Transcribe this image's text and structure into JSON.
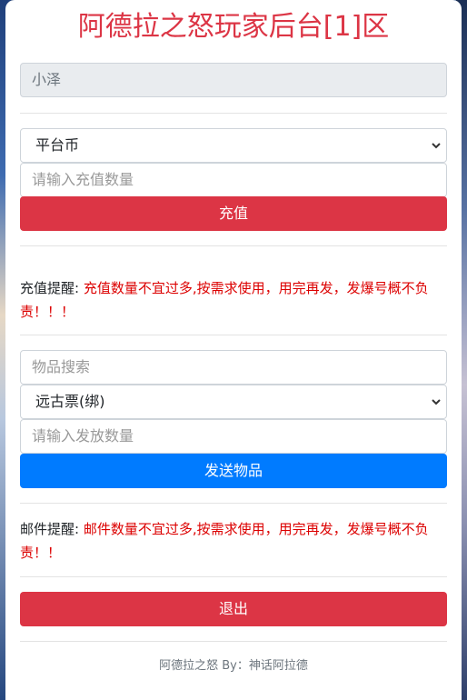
{
  "title": "阿德拉之怒玩家后台[1]区",
  "player_name": "小泽",
  "recharge": {
    "currency_selected": "平台币",
    "amount_placeholder": "请输入充值数量",
    "submit_label": "充值",
    "notice_label": "充值提醒:",
    "notice_text": "充值数量不宜过多,按需求使用，用完再发，发爆号概不负责！！！"
  },
  "items": {
    "search_placeholder": "物品搜索",
    "item_selected": "远古票(绑)",
    "amount_placeholder": "请输入发放数量",
    "submit_label": "发送物品",
    "notice_label": "邮件提醒:",
    "notice_text": "邮件数量不宜过多,按需求使用，用完再发，发爆号概不负责！！"
  },
  "logout_label": "退出",
  "footer": "阿德拉之怒 By：神话阿拉德",
  "colors": {
    "danger": "#dc3545",
    "primary": "#007bff",
    "warning_text": "#dc0000"
  }
}
